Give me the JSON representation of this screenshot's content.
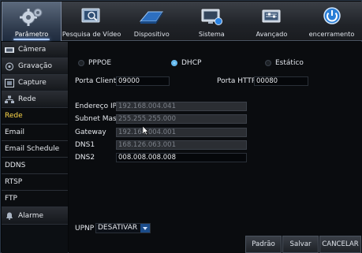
{
  "toolbar": {
    "items": [
      {
        "label": "Parâmetro",
        "icon": "gears-icon",
        "active": true
      },
      {
        "label": "Pesquisa de Vídeo",
        "icon": "video-search-icon",
        "active": false
      },
      {
        "label": "Dispositivo",
        "icon": "hard-drive-icon",
        "active": false
      },
      {
        "label": "Sistema",
        "icon": "monitor-icon",
        "active": false
      },
      {
        "label": "Avançado",
        "icon": "advanced-settings-icon",
        "active": false
      },
      {
        "label": "encerramento",
        "icon": "power-icon",
        "active": false
      }
    ]
  },
  "sidebar": {
    "items": [
      {
        "label": "Câmera",
        "icon": "camera-icon"
      },
      {
        "label": "Gravação",
        "icon": "record-icon"
      },
      {
        "label": "Capture",
        "icon": "capture-icon"
      },
      {
        "label": "Rede",
        "icon": "network-icon"
      },
      {
        "label": "Rede",
        "active": true
      },
      {
        "label": "Email"
      },
      {
        "label": "Email Schedule"
      },
      {
        "label": "DDNS"
      },
      {
        "label": "RTSP"
      },
      {
        "label": "FTP"
      },
      {
        "label": "Alarme",
        "icon": "alarm-icon"
      }
    ]
  },
  "network": {
    "mode_options": [
      "PPPOE",
      "DHCP",
      "Estático"
    ],
    "mode_selected": "DHCP",
    "client_port_label": "Porta Cliente",
    "client_port": "09000",
    "http_port_label": "Porta HTTP",
    "http_port": "00080",
    "ip_label": "Endereço IP",
    "ip": "192.168.004.041",
    "mask_label": "Subnet Mask",
    "mask": "255.255.255.000",
    "gateway_label": "Gateway",
    "gateway": "192.168.004.001",
    "dns1_label": "DNS1",
    "dns1": "168.126.063.001",
    "dns2_label": "DNS2",
    "dns2": "008.008.008.008",
    "upnp_label": "UPNP",
    "upnp_value": "DESATIVAR"
  },
  "buttons": {
    "default": "Padrão",
    "save": "Salvar",
    "cancel": "CANCELAR"
  },
  "colors": {
    "active_sidebar_text": "#ffd94a",
    "radio_selected": "#2d8fd8"
  }
}
